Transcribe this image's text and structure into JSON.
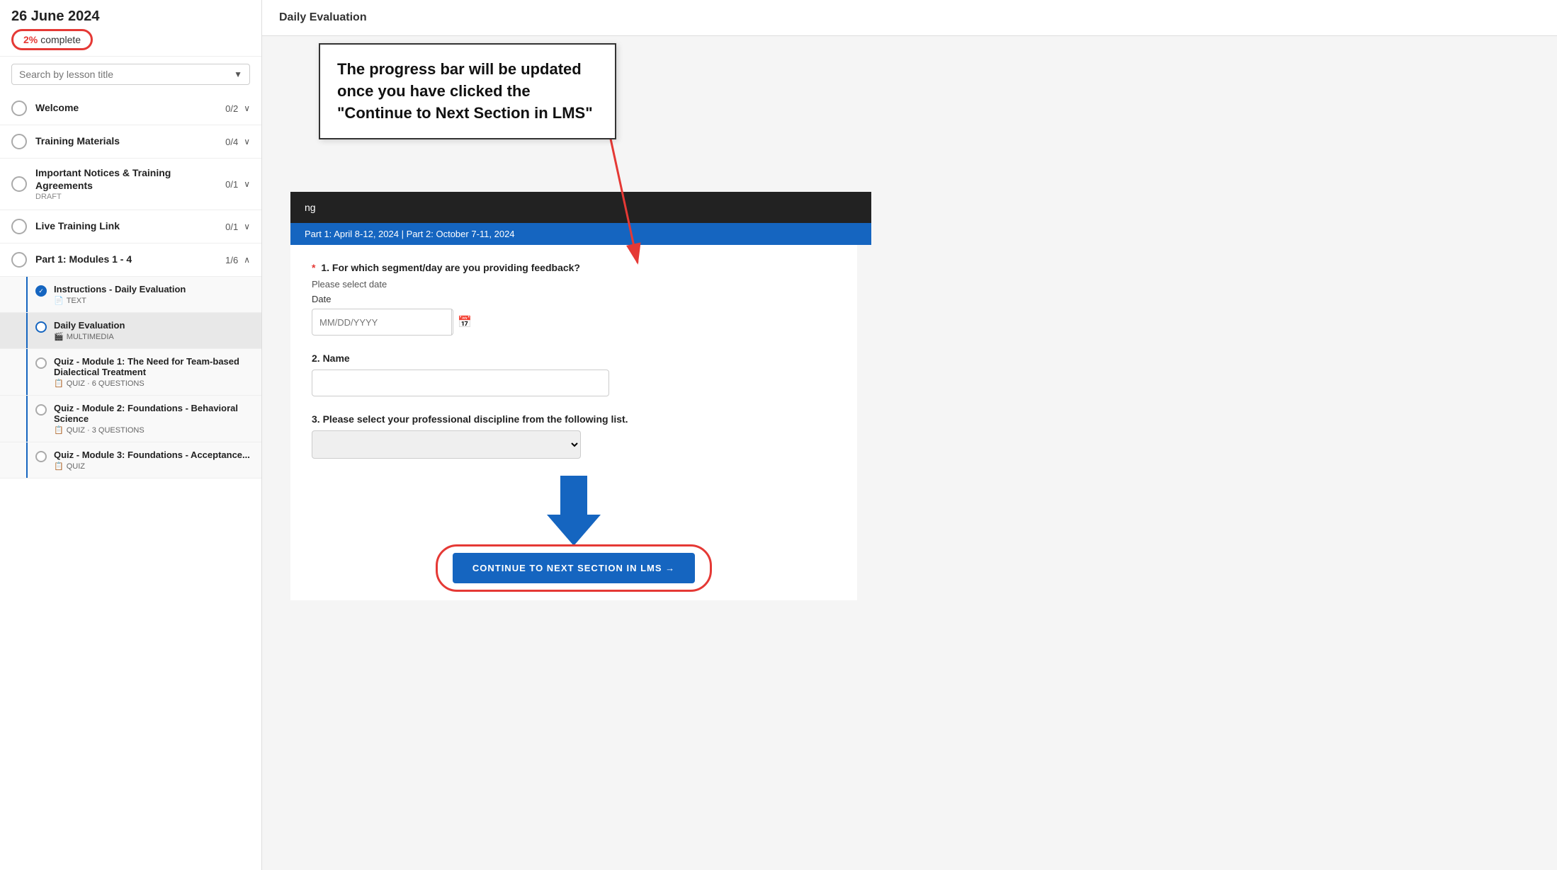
{
  "sidebar": {
    "course_title": "26 June 2024",
    "progress": {
      "percent": "2%",
      "label": "complete"
    },
    "search_placeholder": "Search by lesson title",
    "nav_items": [
      {
        "id": "welcome",
        "title": "Welcome",
        "count": "0/2",
        "expanded": false,
        "circle": "empty"
      },
      {
        "id": "training-materials",
        "title": "Training Materials",
        "count": "0/4",
        "expanded": false,
        "circle": "empty"
      },
      {
        "id": "important-notices",
        "title": "Important Notices & Training Agreements",
        "count": "0/1",
        "expanded": false,
        "circle": "empty",
        "draft": "DRAFT"
      },
      {
        "id": "live-training-link",
        "title": "Live Training Link",
        "count": "0/1",
        "expanded": false,
        "circle": "empty"
      },
      {
        "id": "part1",
        "title": "Part 1: Modules 1 - 4",
        "count": "1/6",
        "expanded": true,
        "circle": "empty"
      }
    ],
    "sub_items": [
      {
        "id": "instructions-daily",
        "title": "Instructions - Daily Evaluation",
        "type": "TEXT",
        "type_icon": "📄",
        "circle": "completed",
        "active": false
      },
      {
        "id": "daily-evaluation",
        "title": "Daily Evaluation",
        "type": "MULTIMEDIA",
        "type_icon": "🎬",
        "circle": "current",
        "active": true
      },
      {
        "id": "quiz-module1",
        "title": "Quiz - Module 1: The Need for Team-based Dialectical Treatment",
        "type": "QUIZ · 6 QUESTIONS",
        "type_icon": "📋",
        "circle": "empty",
        "active": false
      },
      {
        "id": "quiz-module2",
        "title": "Quiz - Module 2: Foundations - Behavioral Science",
        "type": "QUIZ · 3 QUESTIONS",
        "type_icon": "📋",
        "circle": "empty",
        "active": false
      },
      {
        "id": "quiz-module3",
        "title": "Quiz - Module 3: Foundations - Acceptance...",
        "type": "QUIZ",
        "type_icon": "📋",
        "circle": "empty",
        "active": false
      }
    ]
  },
  "main": {
    "header": "Daily Evaluation",
    "tooltip": {
      "text": "The progress bar will be updated once you have clicked the \"Continue to Next Section in LMS\""
    },
    "dark_bar_text": "ng",
    "blue_bar_text": "Part 1: April 8-12, 2024 | Part 2: October 7-11, 2024",
    "form": {
      "q1_label": "1. For which segment/day are you providing feedback?",
      "q1_required": true,
      "q1_sublabel": "Please select date",
      "q1_date_label": "Date",
      "q1_date_placeholder": "MM/DD/YYYY",
      "q2_label": "2. Name",
      "q3_label": "3. Please select your professional discipline from the following list."
    },
    "continue_button": "CONTINUE TO NEXT SECTION IN LMS →"
  }
}
